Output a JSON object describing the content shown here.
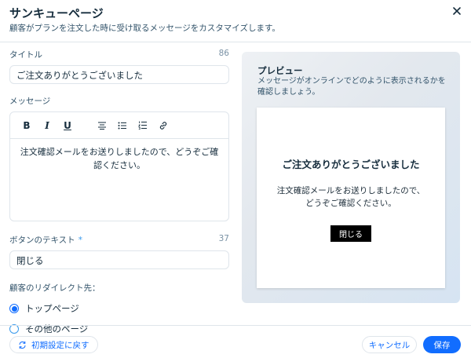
{
  "header": {
    "title": "サンキューページ",
    "subtitle": "顧客がプランを注文した時に受け取るメッセージをカスタマイズします。"
  },
  "fields": {
    "title_label": "タイトル",
    "title_counter": "86",
    "title_value": "ご注文ありがとうございました",
    "message_label": "メッセージ",
    "message_value": "注文確認メールをお送りしましたので、どうぞご確認ください。",
    "button_label": "ボタンのテキスト",
    "button_required": "*",
    "button_counter": "37",
    "button_value": "閉じる",
    "redirect_label": "顧客のリダイレクト先：",
    "redirect_options": [
      "トップページ",
      "その他のページ"
    ],
    "redirect_selected": "トップページ"
  },
  "toolbar": {
    "bold": "B",
    "italic": "I",
    "underline": "U"
  },
  "preview": {
    "title": "プレビュー",
    "description": "メッセージがオンラインでどのように表示されるかを確認しましょう。",
    "card_title": "ご注文ありがとうございました",
    "card_message_line1": "注文確認メールをお送りしましたので、",
    "card_message_line2": "どうぞご確認ください。",
    "card_button": "閉じる"
  },
  "footer": {
    "reset_label": "初期設定に戻す",
    "cancel_label": "キャンセル",
    "save_label": "保存"
  },
  "colors": {
    "accent": "#116dff",
    "text": "#162d3d"
  }
}
